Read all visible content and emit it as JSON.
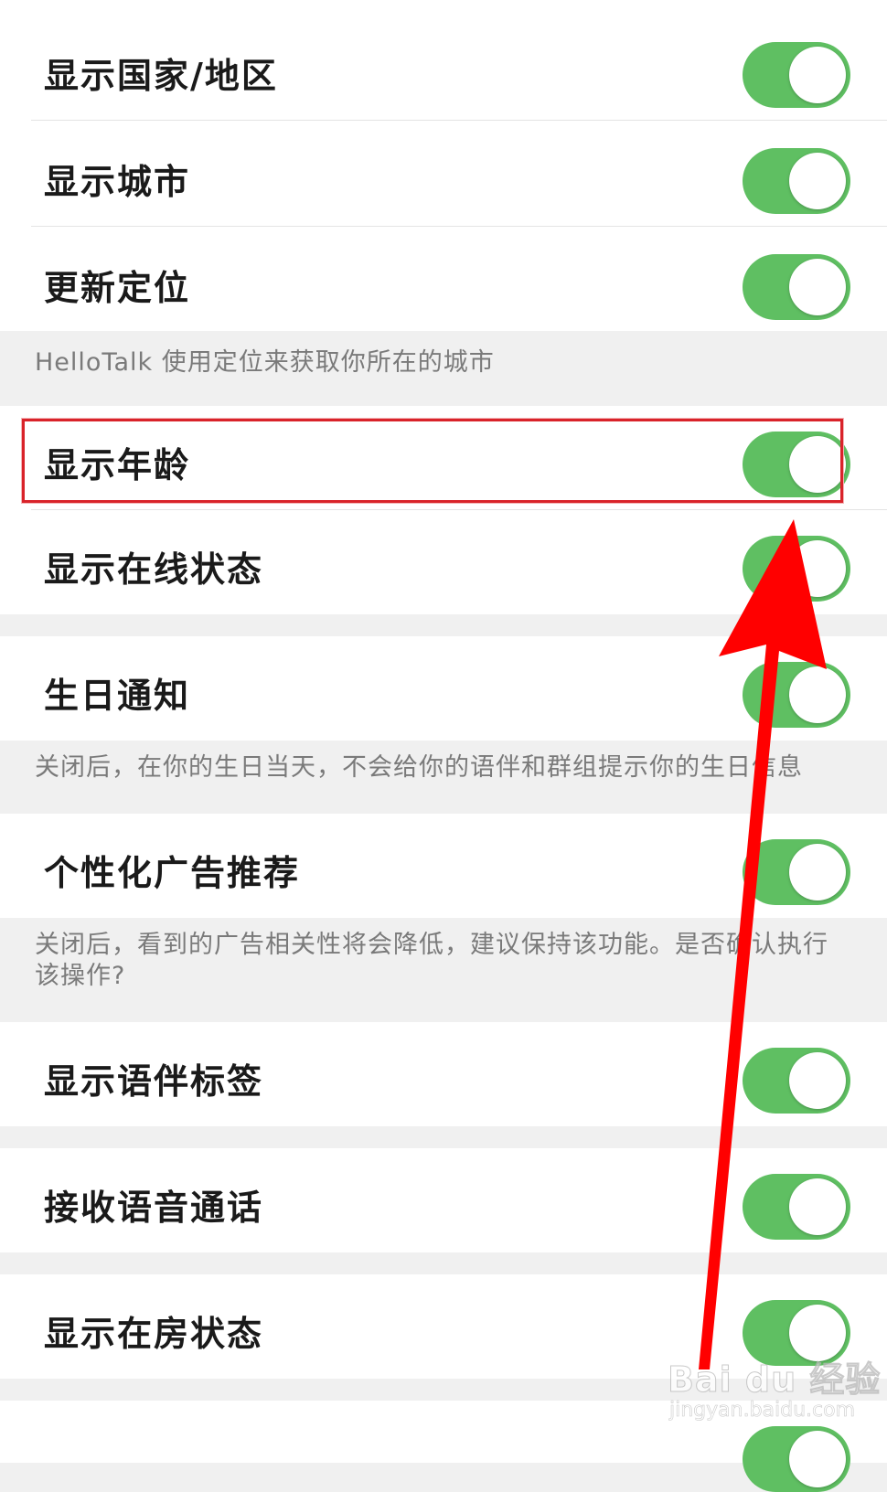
{
  "settings": [
    {
      "label": "显示国家/地区",
      "on": true
    },
    {
      "label": "显示城市",
      "on": true
    },
    {
      "label": "更新定位",
      "on": true
    },
    {
      "label": "显示年龄",
      "on": true
    },
    {
      "label": "显示在线状态",
      "on": true
    },
    {
      "label": "生日通知",
      "on": true
    },
    {
      "label": "个性化广告推荐",
      "on": true
    },
    {
      "label": "显示语伴标签",
      "on": true
    },
    {
      "label": "接收语音通话",
      "on": true
    },
    {
      "label": "显示在房状态",
      "on": true
    }
  ],
  "notes": {
    "location": "HelloTalk 使用定位来获取你所在的城市",
    "birthday": "关闭后，在你的生日当天，不会给你的语伴和群组提示你的生日信息",
    "ads": "关闭后，看到的广告相关性将会降低，建议保持该功能。是否确认执行该操作?"
  },
  "watermark": {
    "brand": "Bai du 经验",
    "url": "jingyan.baidu.com"
  },
  "colors": {
    "toggle_on": "#5fbf62",
    "highlight": "#d9232a",
    "arrow": "#ff0000",
    "background": "#f0f0f0"
  }
}
